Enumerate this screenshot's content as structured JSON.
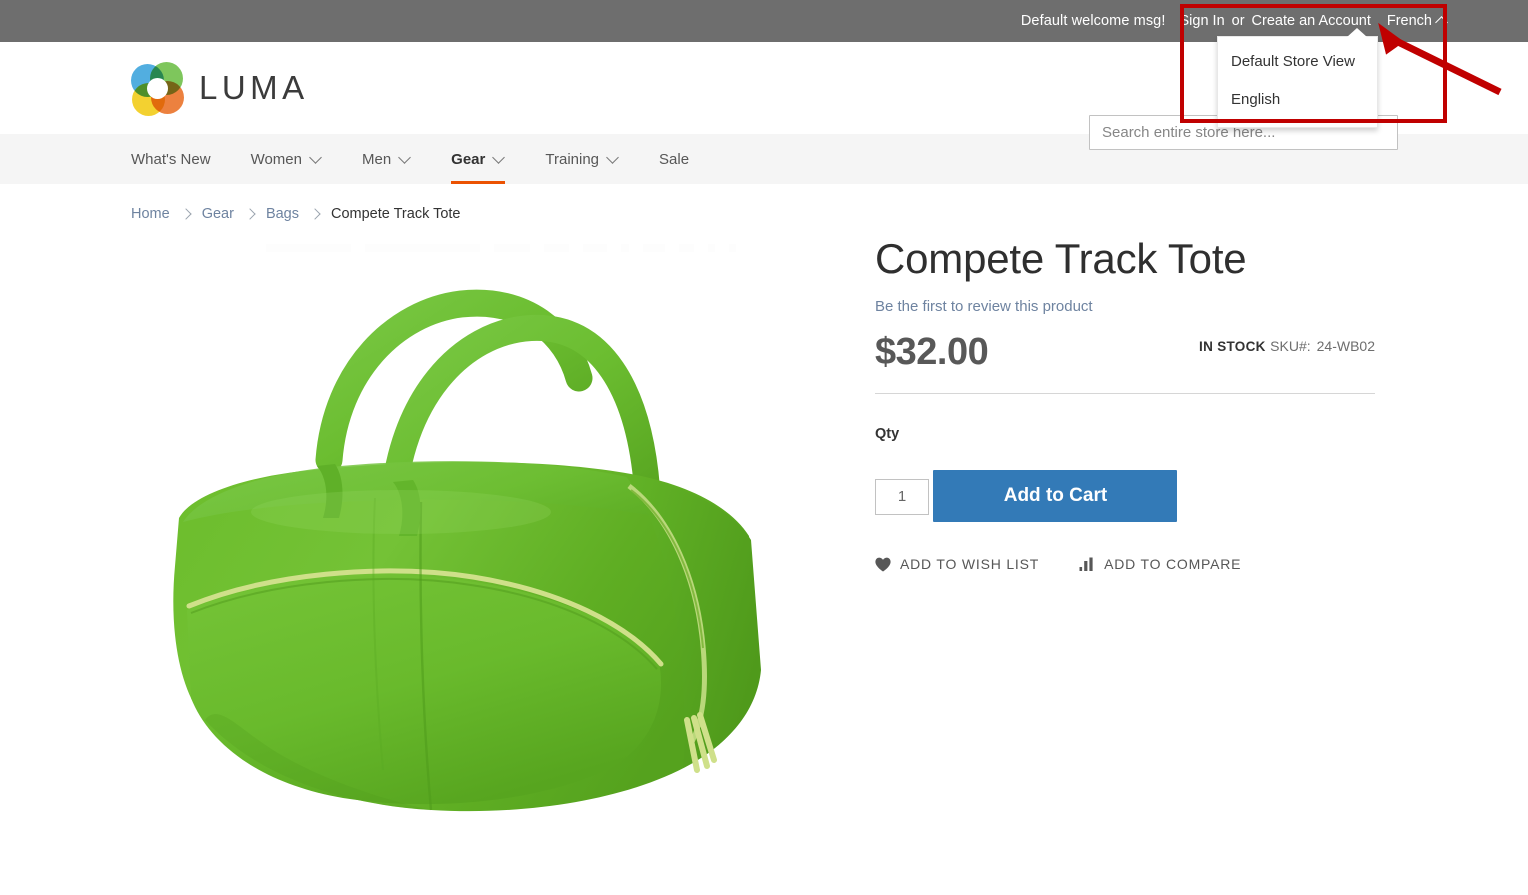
{
  "topbar": {
    "welcome_message": "Default welcome msg!",
    "sign_in_label": "Sign In",
    "separator": "or",
    "create_account_label": "Create an Account",
    "language_switcher_label": "French",
    "background_color": "#6e6e6e"
  },
  "language_dropdown": {
    "visible": true,
    "items": [
      {
        "label": "Default Store View"
      },
      {
        "label": "English"
      }
    ]
  },
  "header": {
    "logo_text": "LUMA",
    "logo_colors": {
      "blue": "#3aa3dc",
      "green": "#6cbe45",
      "orange": "#ea7024",
      "yellow": "#f2cb13"
    }
  },
  "search": {
    "placeholder": "Search entire store here...",
    "value": ""
  },
  "nav": {
    "items": [
      {
        "label": "What's New",
        "has_chevron": false,
        "active": false
      },
      {
        "label": "Women",
        "has_chevron": true,
        "active": false
      },
      {
        "label": "Men",
        "has_chevron": true,
        "active": false
      },
      {
        "label": "Gear",
        "has_chevron": true,
        "active": true
      },
      {
        "label": "Training",
        "has_chevron": true,
        "active": false
      },
      {
        "label": "Sale",
        "has_chevron": false,
        "active": false
      }
    ],
    "active_underline_color": "#eb5202"
  },
  "breadcrumbs": {
    "items": [
      {
        "label": "Home",
        "is_link": true
      },
      {
        "label": "Gear",
        "is_link": true
      },
      {
        "label": "Bags",
        "is_link": true
      },
      {
        "label": "Compete Track Tote",
        "is_link": false
      }
    ]
  },
  "product": {
    "title": "Compete Track Tote",
    "review_link": "Be the first to review this product",
    "price": "$32.00",
    "stock_status": "IN STOCK",
    "sku_label": "SKU#:",
    "sku_value": "24-WB02",
    "qty_label": "Qty",
    "qty_value": "1",
    "add_to_cart_label": "Add to Cart",
    "add_to_cart_color": "#337ab7",
    "wishlist_label": "ADD TO WISH LIST",
    "compare_label": "ADD TO COMPARE",
    "image_alt": "Green duffel tote bag",
    "image_main_color": "#6cbe2e",
    "image_shadow_color": "#4e9420",
    "image_zipper_color": "#cfe08a"
  },
  "annotation": {
    "box_color": "#c00000",
    "arrow_color": "#c00000",
    "target": "language-switcher"
  }
}
